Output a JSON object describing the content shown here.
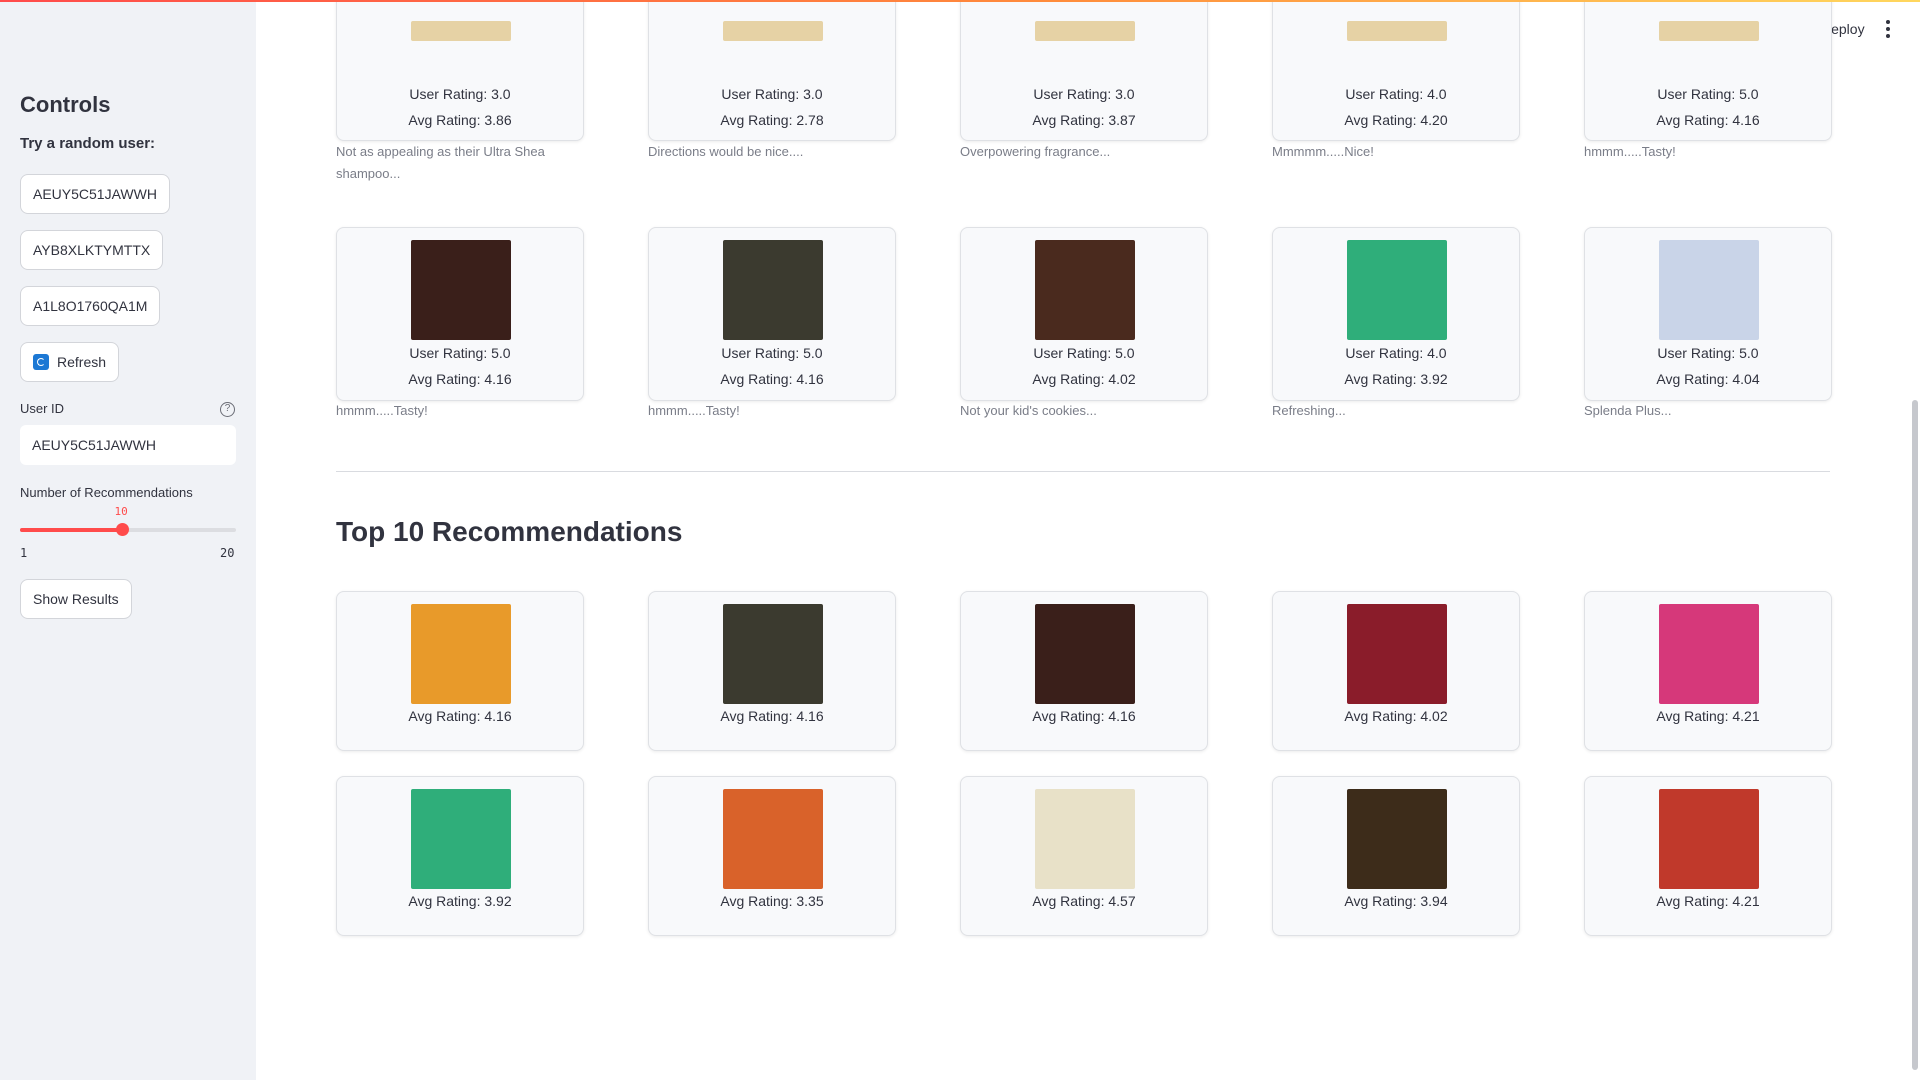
{
  "header": {
    "deploy_label": "Deploy"
  },
  "sidebar": {
    "title": "Controls",
    "random_user_label": "Try a random user:",
    "random_users": [
      "AEUY5C51JAWWH",
      "AYB8XLKTYMTTX",
      "A1L8O1760QA1M"
    ],
    "refresh_label": "Refresh",
    "user_id_label": "User ID",
    "user_id_value": "AEUY5C51JAWWH",
    "num_recs_label": "Number of Recommendations",
    "num_recs_value": "10",
    "num_recs_min": "1",
    "num_recs_max": "20",
    "num_recs_fraction": 0.47,
    "show_results_label": "Show Results"
  },
  "rated_partial": [
    {
      "user_rating": "User Rating: 3.0",
      "avg_rating": "Avg Rating: 3.86",
      "review": "Not as appealing as their Ultra Shea shampoo..."
    },
    {
      "user_rating": "User Rating: 3.0",
      "avg_rating": "Avg Rating: 2.78",
      "review": "Directions would be nice...."
    },
    {
      "user_rating": "User Rating: 3.0",
      "avg_rating": "Avg Rating: 3.87",
      "review": "Overpowering fragrance..."
    },
    {
      "user_rating": "User Rating: 4.0",
      "avg_rating": "Avg Rating: 4.20",
      "review": "Mmmmm.....Nice!"
    },
    {
      "user_rating": "User Rating: 5.0",
      "avg_rating": "Avg Rating: 4.16",
      "review": "hmmm.....Tasty!"
    }
  ],
  "rated_full": [
    {
      "user_rating": "User Rating: 5.0",
      "avg_rating": "Avg Rating: 4.16",
      "review": "hmmm.....Tasty!",
      "img_color": "#3a1f1a"
    },
    {
      "user_rating": "User Rating: 5.0",
      "avg_rating": "Avg Rating: 4.16",
      "review": "hmmm.....Tasty!",
      "img_color": "#3b3a2f"
    },
    {
      "user_rating": "User Rating: 5.0",
      "avg_rating": "Avg Rating: 4.02",
      "review": "Not your kid's cookies...",
      "img_color": "#4a2a1e"
    },
    {
      "user_rating": "User Rating: 4.0",
      "avg_rating": "Avg Rating: 3.92",
      "review": "Refreshing...",
      "img_color": "#2fae7a"
    },
    {
      "user_rating": "User Rating: 5.0",
      "avg_rating": "Avg Rating: 4.04",
      "review": "Splenda Plus...",
      "img_color": "#c9d4e8"
    }
  ],
  "recommendations": {
    "title": "Top 10 Recommendations",
    "items": [
      {
        "avg_rating": "Avg Rating: 4.16",
        "img_color": "#e89a2a"
      },
      {
        "avg_rating": "Avg Rating: 4.16",
        "img_color": "#3b3a2f"
      },
      {
        "avg_rating": "Avg Rating: 4.16",
        "img_color": "#3a1f1a"
      },
      {
        "avg_rating": "Avg Rating: 4.02",
        "img_color": "#8a1c2a"
      },
      {
        "avg_rating": "Avg Rating: 4.21",
        "img_color": "#d6387a"
      },
      {
        "avg_rating": "Avg Rating: 3.92",
        "img_color": "#2fae7a"
      },
      {
        "avg_rating": "Avg Rating: 3.35",
        "img_color": "#d9622a"
      },
      {
        "avg_rating": "Avg Rating: 4.57",
        "img_color": "#e8e1c8"
      },
      {
        "avg_rating": "Avg Rating: 3.94",
        "img_color": "#3d2c1a"
      },
      {
        "avg_rating": "Avg Rating: 4.21",
        "img_color": "#c0392b"
      }
    ]
  }
}
